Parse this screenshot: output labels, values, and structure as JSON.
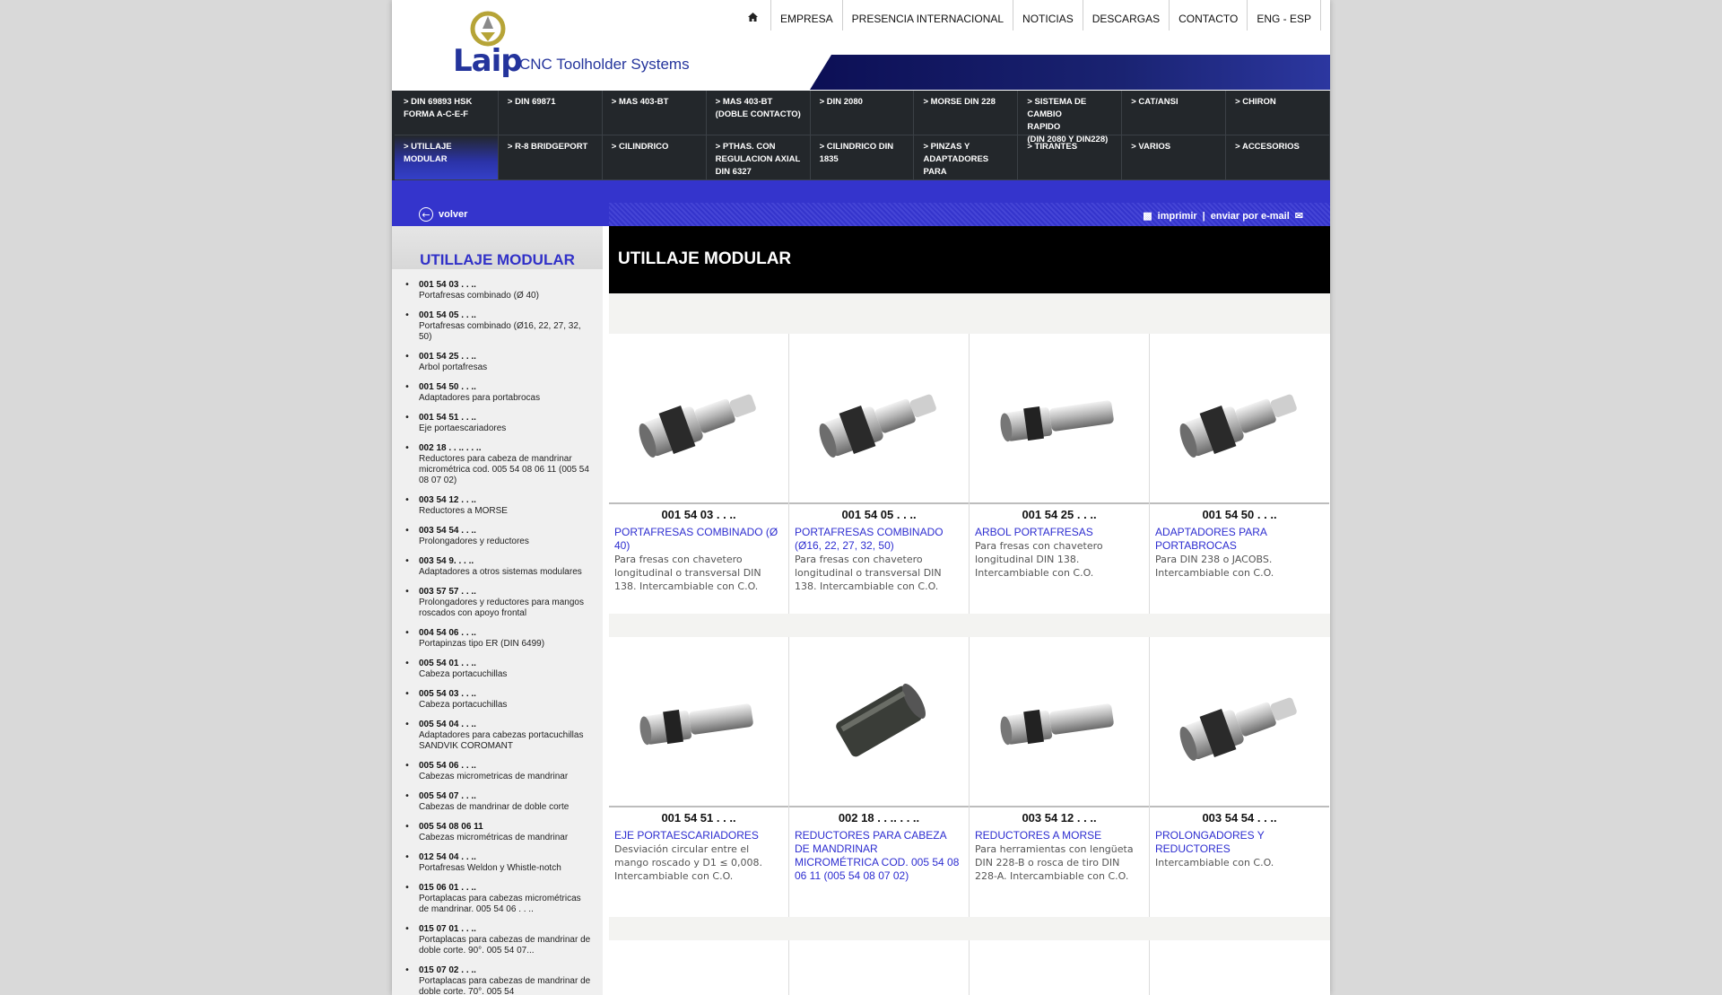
{
  "header": {
    "brand": "Laip",
    "tagline": "CNC Toolholder Systems",
    "topnav": [
      "EMPRESA",
      "PRESENCIA INTERNACIONAL",
      "NOTICIAS",
      "DESCARGAS",
      "CONTACTO",
      "ENG - ESP"
    ],
    "home_icon": "home-icon"
  },
  "menu": {
    "row1": [
      "> DIN 69893 HSK\n  FORMA A-C-E-F",
      "> DIN 69871",
      "> MAS 403-BT",
      "> MAS 403-BT\n  (Doble Contacto)",
      "> DIN 2080",
      "> MORSE DIN 228",
      "> SISTEMA DE CAMBIO\n  RAPIDO\n  (DIN 2080 y DIN228)",
      "> CAT/ANSI",
      "> CHIRON"
    ],
    "row2": [
      "> UTILLAJE MODULAR",
      "> R-8 BRIDGEPORT",
      "> CILINDRICO",
      "> PTHAS. CON\n  REGULACION AXIAL\n  DIN 6327",
      "> CILINDRICO DIN 1835",
      "> PINZAS Y\n  ADAPTADORES PARA\n  PORTAMACHOS",
      "> TIRANTES",
      "> VARIOS",
      "> ACCESORIOS"
    ]
  },
  "toolbar": {
    "back_label": "volver",
    "print_label": "imprimir",
    "separator": "|",
    "email_label": "enviar por e-mail"
  },
  "sidebar": {
    "title": "UTILLAJE MODULAR",
    "items": [
      {
        "code": "001 54 03 . . ..",
        "desc": "Portafresas combinado (Ø 40)"
      },
      {
        "code": "001 54 05 . . ..",
        "desc": "Portafresas combinado (Ø16, 22, 27, 32, 50)"
      },
      {
        "code": "001 54 25 . . ..",
        "desc": "Arbol portafresas"
      },
      {
        "code": "001 54 50 . . ..",
        "desc": "Adaptadores para portabrocas"
      },
      {
        "code": "001 54 51 . . ..",
        "desc": "Eje portaescariadores"
      },
      {
        "code": "002 18 . . .. . . ..",
        "desc": "Reductores para cabeza de mandrinar micrométrica cod. 005 54 08 06 11 (005 54 08 07 02)"
      },
      {
        "code": "003 54 12 . . ..",
        "desc": "Reductores a MORSE"
      },
      {
        "code": "003 54 54 . . ..",
        "desc": "Prolongadores y reductores"
      },
      {
        "code": "003 54 9. . . ..",
        "desc": "Adaptadores a otros sistemas modulares"
      },
      {
        "code": "003 57 57 . . ..",
        "desc": "Prolongadores y reductores para mangos roscados con apoyo frontal"
      },
      {
        "code": "004 54 06 . . ..",
        "desc": "Portapinzas tipo ER (DIN 6499)"
      },
      {
        "code": "005 54 01 . . ..",
        "desc": "Cabeza portacuchillas"
      },
      {
        "code": "005 54 03 . . ..",
        "desc": "Cabeza portacuchillas"
      },
      {
        "code": "005 54 04 . . ..",
        "desc": "Adaptadores para cabezas portacuchillas SANDVIK COROMANT"
      },
      {
        "code": "005 54 06 . . ..",
        "desc": "Cabezas micrometricas de mandrinar"
      },
      {
        "code": "005 54 07 . . ..",
        "desc": "Cabezas de mandrinar de doble corte"
      },
      {
        "code": "005 54 08 06 11",
        "desc": "Cabezas micrométricas de mandrinar"
      },
      {
        "code": "012 54 04 . . ..",
        "desc": "Portafresas Weldon y Whistle-notch"
      },
      {
        "code": "015 06 01 . . ..",
        "desc": "Portaplacas para cabezas micrométricas de mandrinar. 005 54 06 . . .."
      },
      {
        "code": "015 07 01 . . ..",
        "desc": "Portaplacas para cabezas de mandrinar de doble corte. 90°. 005 54 07..."
      },
      {
        "code": "015 07 02 . . ..",
        "desc": "Portaplacas para cabezas de mandrinar de doble corte. 70°. 005 54"
      }
    ]
  },
  "main": {
    "title": "UTILLAJE MODULAR",
    "rows": [
      [
        {
          "code": "001 54 03 . . ..",
          "name": "PORTAFRESAS COMBINADO (Ø 40)",
          "desc": "Para fresas con chavetero longitudinal o transversal DIN 138. Intercambiable con C.O.",
          "image": "modular-milling-holder"
        },
        {
          "code": "001 54 05 . . ..",
          "name": "PORTAFRESAS COMBINADO (Ø16, 22, 27, 32, 50)",
          "desc": "Para fresas con chavetero longitudinal o transversal DIN 138. Intercambiable con C.O.",
          "image": "modular-milling-holder"
        },
        {
          "code": "001 54 25 . . ..",
          "name": "ARBOL PORTAFRESAS",
          "desc": "Para fresas con chavetero longitudinal DIN 138. Intercambiable con C.O.",
          "image": "arbor"
        },
        {
          "code": "001 54 50 . . ..",
          "name": "ADAPTADORES PARA PORTABROCAS",
          "desc": "Para DIN 238 o JACOBS. Intercambiable con C.O.",
          "image": "chuck-adapter"
        }
      ],
      [
        {
          "code": "001 54 51 . . ..",
          "name": "EJE PORTAESCARIADORES",
          "desc": "Desviación circular entre el mango roscado y D1 ≤ 0,008. Intercambiable con C.O.",
          "image": "reamer-shaft"
        },
        {
          "code": "002 18 . . .. . . ..",
          "name": "REDUCTORES PARA CABEZA DE MANDRINAR MICROMÉTRICA COD. 005 54 08 06 11 (005 54 08 07 02)",
          "desc": "",
          "image": "sleeve"
        },
        {
          "code": "003 54 12 . . ..",
          "name": "REDUCTORES A MORSE",
          "desc": "Para herramientas con lengüeta DIN 228-B o rosca de tiro DIN 228-A. Intercambiable con C.O.",
          "image": "morse-reducer"
        },
        {
          "code": "003 54 54 . . ..",
          "name": "PROLONGADORES Y REDUCTORES",
          "desc": "Intercambiable con C.O.",
          "image": "extension"
        }
      ]
    ]
  },
  "colors": {
    "accent_blue": "#3434cc",
    "link_blue": "#2d2dd0",
    "menu_dark": "#23272b"
  }
}
